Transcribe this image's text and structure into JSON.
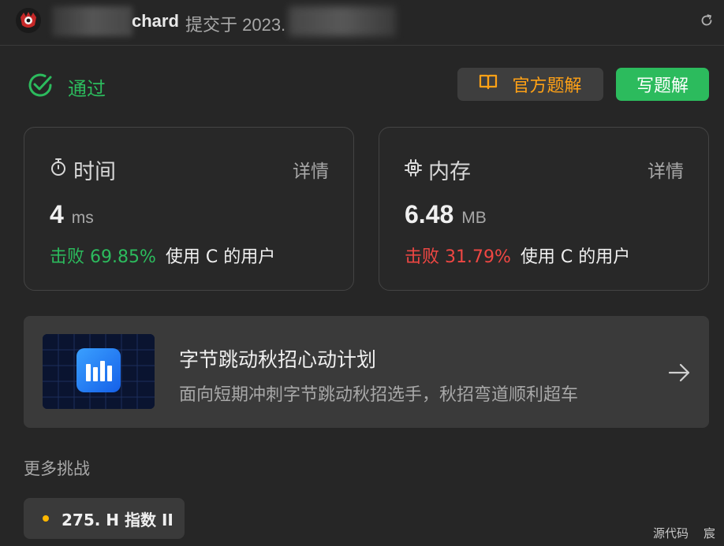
{
  "header": {
    "author_suffix": "chard",
    "submitted_text": "提交于 2023.",
    "refresh_icon": "refresh-icon"
  },
  "result": {
    "status": "通过",
    "status_color": "#2cbb5d",
    "official_solution_label": "官方题解",
    "write_solution_label": "写题解"
  },
  "time_card": {
    "title": "时间",
    "detail": "详情",
    "value": "4",
    "unit": "ms",
    "beat_label": "击败 69.85%",
    "beat_suffix": "使用 C 的用户",
    "beat_color": "#2cbb5d"
  },
  "memory_card": {
    "title": "内存",
    "detail": "详情",
    "value": "6.48",
    "unit": "MB",
    "beat_label": "击败 31.79%",
    "beat_suffix": "使用 C 的用户",
    "beat_color": "#ef4743"
  },
  "promo": {
    "title": "字节跳动秋招心动计划",
    "subtitle": "面向短期冲刺字节跳动秋招选手，秋招弯道顺利超车"
  },
  "more": {
    "heading": "更多挑战",
    "items": [
      {
        "label": "275. H 指数 II",
        "difficulty_color": "#ffb800"
      }
    ]
  },
  "footer": {
    "source_code": "源代码",
    "trailing": "宸"
  }
}
